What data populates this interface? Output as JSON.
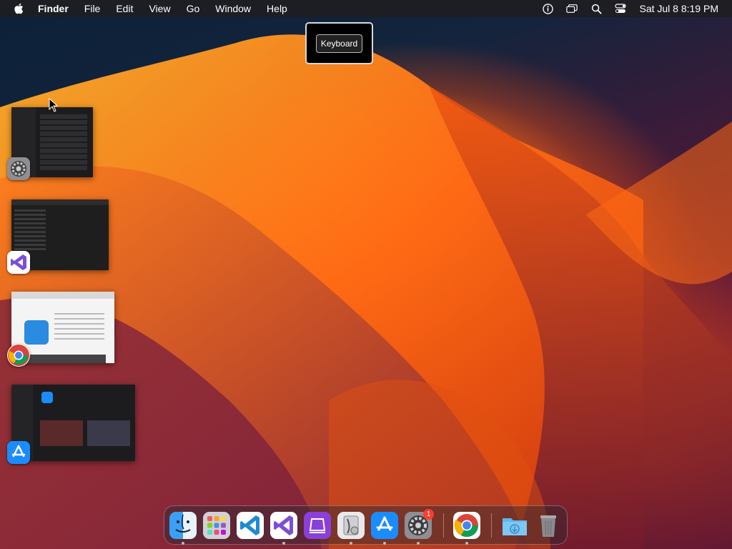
{
  "menubar": {
    "app_name": "Finder",
    "items": [
      "File",
      "Edit",
      "View",
      "Go",
      "Window",
      "Help"
    ],
    "clock": "Sat Jul 8  8:19 PM",
    "status_icons": [
      "accessibility-icon",
      "screen-mirroring-icon",
      "spotlight-search-icon",
      "control-center-icon"
    ]
  },
  "tooltip": {
    "label": "Keyboard"
  },
  "stage_manager": [
    {
      "app": "System Settings",
      "icon": "system-settings-icon"
    },
    {
      "app": "Visual Studio",
      "icon": "visual-studio-icon"
    },
    {
      "app": "Google Chrome",
      "icon": "chrome-icon"
    },
    {
      "app": "App Store",
      "icon": "app-store-icon"
    }
  ],
  "dock": {
    "apps": [
      {
        "name": "Finder",
        "icon": "finder-icon",
        "running": true
      },
      {
        "name": "Launchpad",
        "icon": "launchpad-icon",
        "running": false
      },
      {
        "name": "Visual Studio Code",
        "icon": "vscode-icon",
        "running": false
      },
      {
        "name": "Visual Studio",
        "icon": "visual-studio-icon",
        "running": true
      },
      {
        "name": "Podcasts Purple",
        "icon": "purple-app-icon",
        "running": false
      },
      {
        "name": "Disk Utility",
        "icon": "disk-utility-icon",
        "running": true
      },
      {
        "name": "App Store",
        "icon": "app-store-icon",
        "running": true
      },
      {
        "name": "System Settings",
        "icon": "system-settings-icon",
        "running": true,
        "badge": "1"
      },
      {
        "name": "Google Chrome",
        "icon": "chrome-icon",
        "running": true
      },
      {
        "name": "Downloads",
        "icon": "downloads-folder-icon",
        "running": false
      },
      {
        "name": "Trash",
        "icon": "trash-icon",
        "running": false
      }
    ]
  },
  "colors": {
    "accent_orange": "#ff6a14",
    "menubar_bg": "#1e1e22",
    "badge_red": "#ff3b30"
  }
}
